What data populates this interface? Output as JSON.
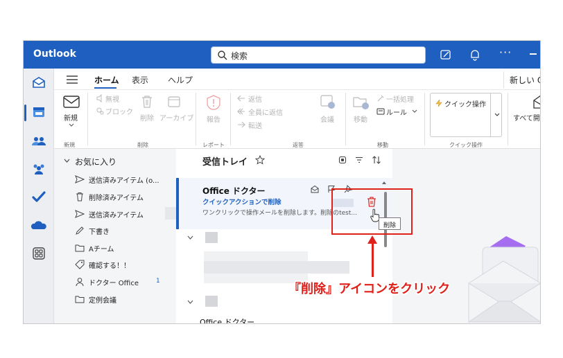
{
  "app": {
    "title": "Outlook"
  },
  "search": {
    "placeholder": "検索"
  },
  "menu": {
    "tabs": [
      {
        "label": "ホーム"
      },
      {
        "label": "表示"
      },
      {
        "label": "ヘルプ"
      }
    ],
    "new_outlook": "新しい Ou"
  },
  "ribbon": {
    "new_label": "新規",
    "ignore": "無視",
    "block": "ブロック",
    "delete": "削除",
    "archive": "アーカイブ",
    "report": "報告",
    "reply": "返信",
    "reply_all": "全員に返信",
    "forward": "転送",
    "meeting": "会議",
    "move": "移動",
    "sweep": "一括処理",
    "rules": "ルール",
    "quick_steps": "クイック操作",
    "mark_all_read": "すべて開封済みに",
    "groups": {
      "new": "新規",
      "delete": "削除",
      "report": "レポート",
      "respond": "返答",
      "move": "移動",
      "quick": "クイック操作"
    }
  },
  "folders": {
    "favorites": "お気に入り",
    "items": [
      {
        "label": "送信済みアイテム (o...",
        "icon": "send-icon"
      },
      {
        "label": "削除済みアイテム",
        "icon": "trash-icon"
      },
      {
        "label": "送信済みアイテム",
        "icon": "send-icon"
      },
      {
        "label": "下書き",
        "icon": "pencil-icon"
      },
      {
        "label": "Aチーム",
        "icon": "folder-icon"
      },
      {
        "label": "確認する！！",
        "icon": "tag-icon"
      },
      {
        "label": "ドクター Office",
        "icon": "person-icon",
        "count": "1"
      },
      {
        "label": "定例会議",
        "icon": "folder-icon"
      }
    ]
  },
  "list": {
    "title": "受信トレイ",
    "message": {
      "sender": "Office ドクター",
      "subject": "クイックアクションで削除",
      "preview": "ワンクリックで操作メールを削除します。削除のtest..."
    },
    "bottom_sender": "Office ドクター"
  },
  "tooltip": {
    "delete": "削除"
  },
  "annotation": {
    "caption": "『削除』アイコンをクリック"
  },
  "colors": {
    "brand": "#1f5fbf",
    "annotation": "#e0201b",
    "pane": "#f4f5f7"
  }
}
